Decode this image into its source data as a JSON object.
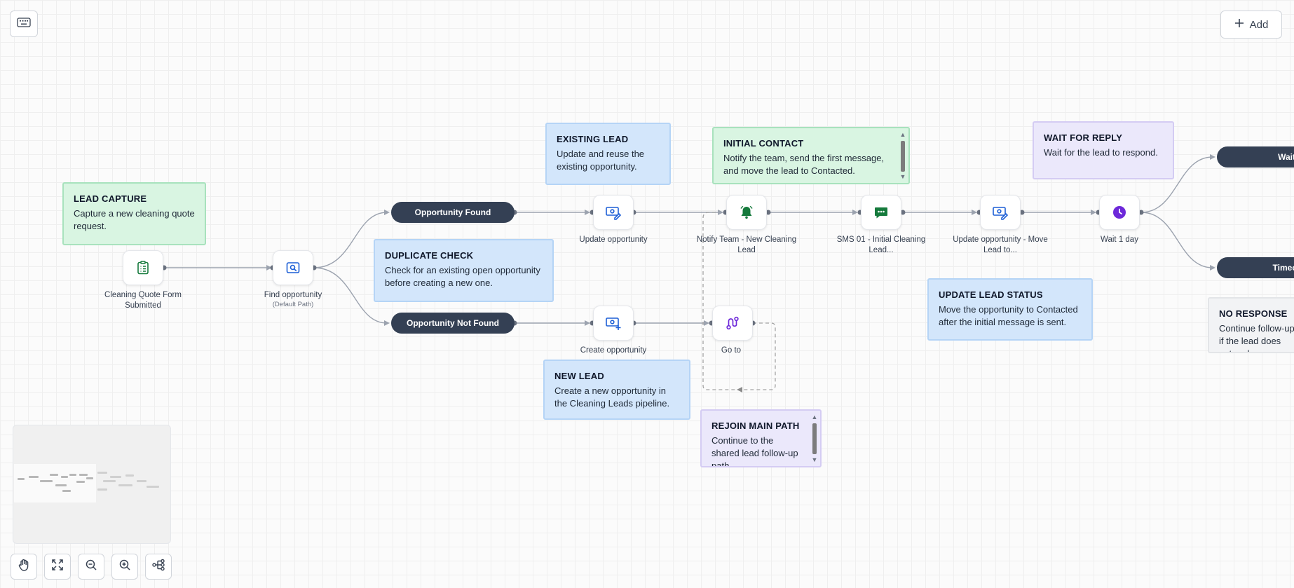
{
  "toolbar": {
    "keyboard_icon": "keyboard-icon",
    "add_label": "Add",
    "add_icon": "plus-icon"
  },
  "notes": {
    "lead_capture": {
      "title": "LEAD CAPTURE",
      "body": "Capture a new cleaning quote request."
    },
    "existing_lead": {
      "title": "EXISTING LEAD",
      "body": "Update and reuse the existing opportunity."
    },
    "duplicate_check": {
      "title": "DUPLICATE CHECK",
      "body": "Check for an existing open opportunity before creating a new one."
    },
    "initial_contact": {
      "title": "INITIAL CONTACT",
      "body": "Notify the team, send the first message, and move the lead to Contacted."
    },
    "wait_for_reply": {
      "title": "WAIT FOR REPLY",
      "body": "Wait for the lead to respond."
    },
    "update_status": {
      "title": "UPDATE LEAD STATUS",
      "body": "Move the opportunity to Contacted after the initial message is sent."
    },
    "new_lead": {
      "title": "NEW LEAD",
      "body": "Create a new opportunity in the Cleaning Leads pipeline."
    },
    "rejoin": {
      "title": "REJOIN MAIN PATH",
      "body": "Continue to the shared lead follow-up path."
    },
    "no_response": {
      "title": "NO RESPONSE",
      "body": "Continue follow-up if the lead does not reply."
    }
  },
  "nodes": {
    "trigger": {
      "label": "Cleaning Quote Form Submitted",
      "icon": "clipboard-list-icon"
    },
    "find": {
      "label": "Find opportunity",
      "sublabel": "(Default Path)",
      "icon": "search-doc-icon"
    },
    "update1": {
      "label": "Update opportunity",
      "icon": "money-edit-icon"
    },
    "create": {
      "label": "Create opportunity",
      "icon": "money-plus-icon"
    },
    "notify": {
      "label": "Notify Team - New Cleaning Lead",
      "icon": "bell-icon"
    },
    "goto": {
      "label": "Go to",
      "icon": "route-icon"
    },
    "sms": {
      "label": "SMS 01 - Initial Cleaning Lead...",
      "icon": "message-icon"
    },
    "update2": {
      "label": "Update opportunity - Move Lead to...",
      "icon": "money-edit-icon"
    },
    "wait": {
      "label": "Wait 1 day",
      "icon": "clock-icon"
    }
  },
  "branches": {
    "found": "Opportunity Found",
    "not_found": "Opportunity Not Found",
    "wait": "Wait",
    "timeout": "Timeout"
  },
  "canvas_controls": {
    "pan": "hand-icon",
    "fit": "expand-icon",
    "zoom_out": "zoom-out-icon",
    "zoom_in": "zoom-in-icon",
    "auto_layout": "workflow-icon"
  },
  "colors": {
    "pill": "#344054",
    "icon_blue": "#1d5fd6",
    "icon_green": "#157a3c",
    "icon_purple": "#6d28d9"
  }
}
